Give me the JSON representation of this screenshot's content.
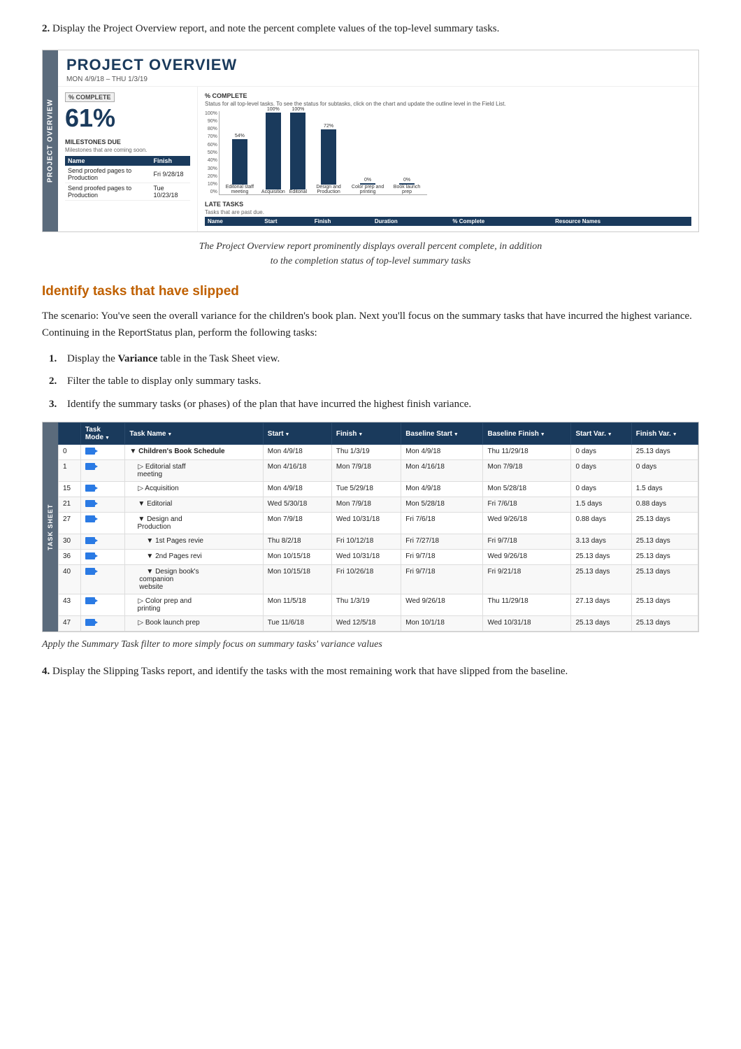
{
  "step2": {
    "heading": "2.",
    "text": "Display the Project Overview report, and note the percent complete values of the top-level summary tasks."
  },
  "projectOverview": {
    "tab_label": "PROJECT OVERVIEW",
    "title": "PROJECT OVERVIEW",
    "date_range": "MON 4/9/18  –  THU 1/3/19",
    "pct_label": "% COMPLETE",
    "pct_value": "61%",
    "milestones_title": "MILESTONES DUE",
    "milestones_sub": "Milestones that are coming soon.",
    "milestone_cols": [
      "Name",
      "Finish"
    ],
    "milestone_rows": [
      {
        "name": "Send proofed pages to Production",
        "finish": "Fri 9/28/18"
      },
      {
        "name": "Send proofed pages to Production",
        "finish": "Tue 10/23/18"
      }
    ],
    "chart_title": "% COMPLETE",
    "chart_sub": "Status for all top-level tasks. To see the status for subtasks, click on the chart and update the outline level in the Field List.",
    "bars": [
      {
        "label": "Editorial staff meeting",
        "value": 54,
        "pct": "54%"
      },
      {
        "label": "Acquisition",
        "value": 100,
        "pct": "100%"
      },
      {
        "label": "Editorial",
        "value": 100,
        "pct": "100%"
      },
      {
        "label": "Design and Production",
        "value": 72,
        "pct": "72%"
      },
      {
        "label": "Color prep and printing",
        "value": 0,
        "pct": "0%"
      },
      {
        "label": "Book launch prep",
        "value": 0,
        "pct": "0%"
      }
    ],
    "late_tasks_title": "LATE TASKS",
    "late_tasks_sub": "Tasks that are past due.",
    "late_cols": [
      "Name",
      "Start",
      "Finish",
      "Duration",
      "% Complete",
      "Resource Names"
    ]
  },
  "caption1": "The Project Overview report prominently displays overall percent complete, in addition\nto the completion status of top-level summary tasks",
  "sectionHeading": "Identify tasks that have slipped",
  "bodyText": "The scenario: You've seen the overall variance for the children's book plan. Next you'll focus on the summary tasks that have incurred the highest variance. Continuing in the ReportStatus plan, perform the following tasks:",
  "stepList": [
    {
      "num": "1.",
      "text": "Display the ",
      "bold": "Variance",
      "text2": " table in the Task Sheet view."
    },
    {
      "num": "2.",
      "text": "Filter the table to display only summary tasks.",
      "bold": "",
      "text2": ""
    },
    {
      "num": "3.",
      "text": "Identify the summary tasks (or phases) of the plan that have incurred the highest finish variance.",
      "bold": "",
      "text2": ""
    }
  ],
  "taskSheet": {
    "tab_label": "TASK SHEET",
    "cols": [
      "Task Mode",
      "Task Name",
      "Start",
      "Finish",
      "Baseline Start",
      "Baseline Finish",
      "Start Var.",
      "Finish Var."
    ],
    "rows": [
      {
        "id": "0",
        "mode": true,
        "name": "Children's Book Schedule",
        "indent": 0,
        "bold": true,
        "collapse": "collapse",
        "start": "Mon 4/9/18",
        "finish": "Thu 1/3/19",
        "base_start": "Mon 4/9/18",
        "base_finish": "Thu 11/29/18",
        "start_var": "0 days",
        "finish_var": "25.13 days"
      },
      {
        "id": "1",
        "mode": true,
        "name": "Editorial staff meeting",
        "indent": 1,
        "bold": false,
        "collapse": "expand",
        "start": "Mon 4/16/18",
        "finish": "Mon 7/9/18",
        "base_start": "Mon 4/16/18",
        "base_finish": "Mon 7/9/18",
        "start_var": "0 days",
        "finish_var": "0 days"
      },
      {
        "id": "15",
        "mode": true,
        "name": "Acquisition",
        "indent": 1,
        "bold": false,
        "collapse": "expand",
        "start": "Mon 4/9/18",
        "finish": "Tue 5/29/18",
        "base_start": "Mon 4/9/18",
        "base_finish": "Mon 5/28/18",
        "start_var": "0 days",
        "finish_var": "1.5 days"
      },
      {
        "id": "21",
        "mode": true,
        "name": "Editorial",
        "indent": 1,
        "bold": false,
        "collapse": "collapse",
        "start": "Wed 5/30/18",
        "finish": "Mon 7/9/18",
        "base_start": "Mon 5/28/18",
        "base_finish": "Fri 7/6/18",
        "start_var": "1.5 days",
        "finish_var": "0.88 days"
      },
      {
        "id": "27",
        "mode": true,
        "name": "Design and Production",
        "indent": 1,
        "bold": false,
        "collapse": "collapse",
        "start": "Mon 7/9/18",
        "finish": "Wed 10/31/18",
        "base_start": "Fri 7/6/18",
        "base_finish": "Wed 9/26/18",
        "start_var": "0.88 days",
        "finish_var": "25.13 days"
      },
      {
        "id": "30",
        "mode": true,
        "name": "1st Pages revie",
        "indent": 2,
        "bold": false,
        "collapse": "collapse",
        "start": "Thu 8/2/18",
        "finish": "Fri 10/12/18",
        "base_start": "Fri 7/27/18",
        "base_finish": "Fri 9/7/18",
        "start_var": "3.13 days",
        "finish_var": "25.13 days"
      },
      {
        "id": "36",
        "mode": true,
        "name": "2nd Pages revi",
        "indent": 2,
        "bold": false,
        "collapse": "collapse",
        "start": "Mon 10/15/18",
        "finish": "Wed 10/31/18",
        "base_start": "Fri 9/7/18",
        "base_finish": "Wed 9/26/18",
        "start_var": "25.13 days",
        "finish_var": "25.13 days"
      },
      {
        "id": "40",
        "mode": true,
        "name": "Design book's companion website",
        "indent": 2,
        "bold": false,
        "collapse": "collapse",
        "start": "Mon 10/15/18",
        "finish": "Fri 10/26/18",
        "base_start": "Fri 9/7/18",
        "base_finish": "Fri 9/21/18",
        "start_var": "25.13 days",
        "finish_var": "25.13 days"
      },
      {
        "id": "43",
        "mode": true,
        "name": "Color prep and printing",
        "indent": 1,
        "bold": false,
        "collapse": "expand",
        "start": "Mon 11/5/18",
        "finish": "Thu 1/3/19",
        "base_start": "Wed 9/26/18",
        "base_finish": "Thu 11/29/18",
        "start_var": "27.13 days",
        "finish_var": "25.13 days"
      },
      {
        "id": "47",
        "mode": true,
        "name": "Book launch prep",
        "indent": 1,
        "bold": false,
        "collapse": "expand",
        "start": "Tue 11/6/18",
        "finish": "Wed 12/5/18",
        "base_start": "Mon 10/1/18",
        "base_finish": "Wed 10/31/18",
        "start_var": "25.13 days",
        "finish_var": "25.13 days"
      }
    ]
  },
  "caption2": "Apply the Summary Task filter to more simply focus on summary tasks' variance values",
  "step4": {
    "num": "4.",
    "text": "Display the Slipping Tasks report, and identify the tasks with the most remaining work that have slipped from the baseline."
  }
}
